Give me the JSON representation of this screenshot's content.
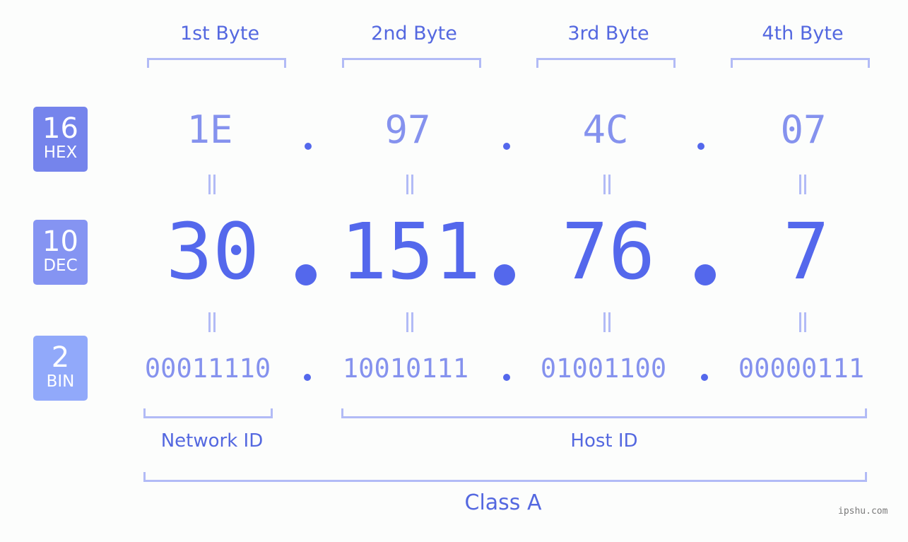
{
  "byte_headers": [
    "1st Byte",
    "2nd Byte",
    "3rd Byte",
    "4th Byte"
  ],
  "bases": [
    {
      "number": "16",
      "unit": "HEX",
      "color": "#7584ec"
    },
    {
      "number": "10",
      "unit": "DEC",
      "color": "#8594f2"
    },
    {
      "number": "2",
      "unit": "BIN",
      "color": "#91a9fa"
    }
  ],
  "ip": {
    "hex": [
      "1E",
      "97",
      "4C",
      "07"
    ],
    "dec": [
      "30",
      "151",
      "76",
      "7"
    ],
    "bin": [
      "00011110",
      "10010111",
      "01001100",
      "00000111"
    ]
  },
  "sections": {
    "network_id": "Network ID",
    "host_id": "Host ID",
    "class": "Class A"
  },
  "watermark": "ipshu.com"
}
